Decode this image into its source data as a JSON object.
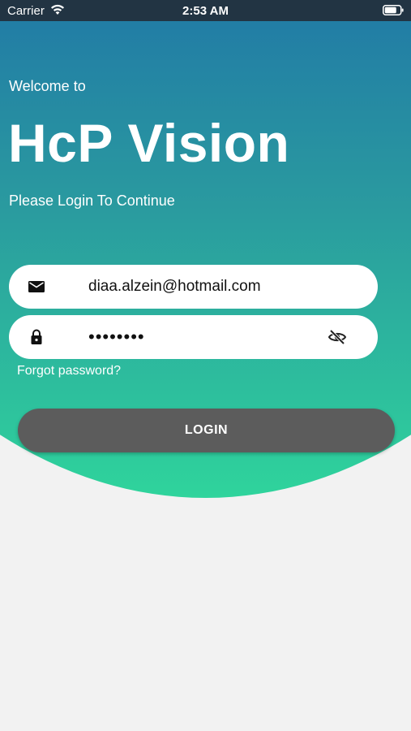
{
  "status_bar": {
    "carrier": "Carrier",
    "time": "2:53 AM",
    "wifi_icon": "wifi-icon",
    "battery_icon": "battery-icon"
  },
  "header": {
    "welcome": "Welcome to",
    "title": "HcP Vision",
    "subtitle": "Please Login To Continue"
  },
  "form": {
    "email": {
      "value": "diaa.alzein@hotmail.com",
      "icon": "mail-icon"
    },
    "password": {
      "value": "••••••••",
      "icon": "lock-icon",
      "toggle_icon": "eye-off-icon"
    },
    "forgot_password": "Forgot password?",
    "login_label": "LOGIN"
  },
  "colors": {
    "gradient_top": "#217aa6",
    "gradient_bottom": "#2fd49c",
    "button": "#5c5c5c",
    "background": "#f2f2f2"
  }
}
